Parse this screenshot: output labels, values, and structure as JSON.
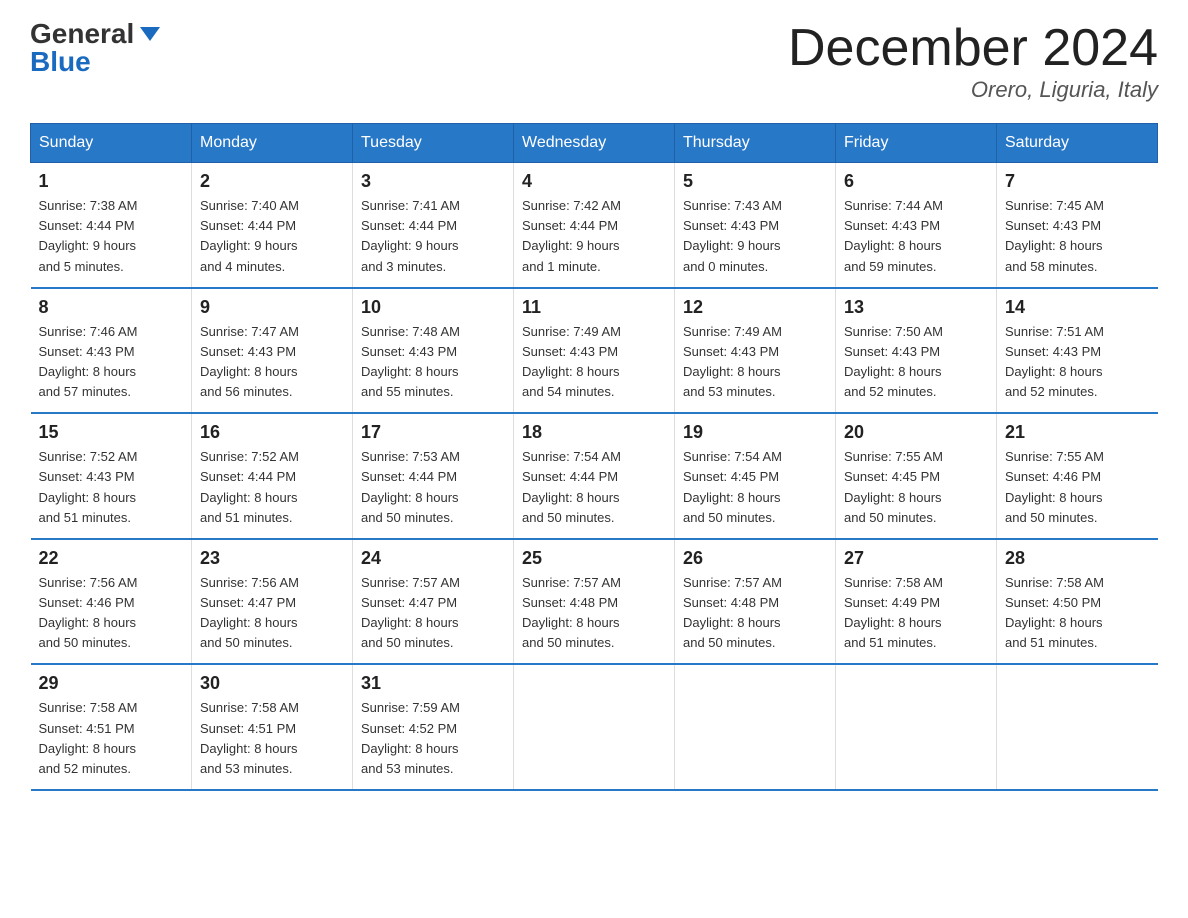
{
  "logo": {
    "general": "General",
    "blue": "Blue"
  },
  "title": "December 2024",
  "location": "Orero, Liguria, Italy",
  "days_of_week": [
    "Sunday",
    "Monday",
    "Tuesday",
    "Wednesday",
    "Thursday",
    "Friday",
    "Saturday"
  ],
  "weeks": [
    [
      {
        "num": "1",
        "sunrise": "7:38 AM",
        "sunset": "4:44 PM",
        "daylight": "9 hours and 5 minutes."
      },
      {
        "num": "2",
        "sunrise": "7:40 AM",
        "sunset": "4:44 PM",
        "daylight": "9 hours and 4 minutes."
      },
      {
        "num": "3",
        "sunrise": "7:41 AM",
        "sunset": "4:44 PM",
        "daylight": "9 hours and 3 minutes."
      },
      {
        "num": "4",
        "sunrise": "7:42 AM",
        "sunset": "4:44 PM",
        "daylight": "9 hours and 1 minute."
      },
      {
        "num": "5",
        "sunrise": "7:43 AM",
        "sunset": "4:43 PM",
        "daylight": "9 hours and 0 minutes."
      },
      {
        "num": "6",
        "sunrise": "7:44 AM",
        "sunset": "4:43 PM",
        "daylight": "8 hours and 59 minutes."
      },
      {
        "num": "7",
        "sunrise": "7:45 AM",
        "sunset": "4:43 PM",
        "daylight": "8 hours and 58 minutes."
      }
    ],
    [
      {
        "num": "8",
        "sunrise": "7:46 AM",
        "sunset": "4:43 PM",
        "daylight": "8 hours and 57 minutes."
      },
      {
        "num": "9",
        "sunrise": "7:47 AM",
        "sunset": "4:43 PM",
        "daylight": "8 hours and 56 minutes."
      },
      {
        "num": "10",
        "sunrise": "7:48 AM",
        "sunset": "4:43 PM",
        "daylight": "8 hours and 55 minutes."
      },
      {
        "num": "11",
        "sunrise": "7:49 AM",
        "sunset": "4:43 PM",
        "daylight": "8 hours and 54 minutes."
      },
      {
        "num": "12",
        "sunrise": "7:49 AM",
        "sunset": "4:43 PM",
        "daylight": "8 hours and 53 minutes."
      },
      {
        "num": "13",
        "sunrise": "7:50 AM",
        "sunset": "4:43 PM",
        "daylight": "8 hours and 52 minutes."
      },
      {
        "num": "14",
        "sunrise": "7:51 AM",
        "sunset": "4:43 PM",
        "daylight": "8 hours and 52 minutes."
      }
    ],
    [
      {
        "num": "15",
        "sunrise": "7:52 AM",
        "sunset": "4:43 PM",
        "daylight": "8 hours and 51 minutes."
      },
      {
        "num": "16",
        "sunrise": "7:52 AM",
        "sunset": "4:44 PM",
        "daylight": "8 hours and 51 minutes."
      },
      {
        "num": "17",
        "sunrise": "7:53 AM",
        "sunset": "4:44 PM",
        "daylight": "8 hours and 50 minutes."
      },
      {
        "num": "18",
        "sunrise": "7:54 AM",
        "sunset": "4:44 PM",
        "daylight": "8 hours and 50 minutes."
      },
      {
        "num": "19",
        "sunrise": "7:54 AM",
        "sunset": "4:45 PM",
        "daylight": "8 hours and 50 minutes."
      },
      {
        "num": "20",
        "sunrise": "7:55 AM",
        "sunset": "4:45 PM",
        "daylight": "8 hours and 50 minutes."
      },
      {
        "num": "21",
        "sunrise": "7:55 AM",
        "sunset": "4:46 PM",
        "daylight": "8 hours and 50 minutes."
      }
    ],
    [
      {
        "num": "22",
        "sunrise": "7:56 AM",
        "sunset": "4:46 PM",
        "daylight": "8 hours and 50 minutes."
      },
      {
        "num": "23",
        "sunrise": "7:56 AM",
        "sunset": "4:47 PM",
        "daylight": "8 hours and 50 minutes."
      },
      {
        "num": "24",
        "sunrise": "7:57 AM",
        "sunset": "4:47 PM",
        "daylight": "8 hours and 50 minutes."
      },
      {
        "num": "25",
        "sunrise": "7:57 AM",
        "sunset": "4:48 PM",
        "daylight": "8 hours and 50 minutes."
      },
      {
        "num": "26",
        "sunrise": "7:57 AM",
        "sunset": "4:48 PM",
        "daylight": "8 hours and 50 minutes."
      },
      {
        "num": "27",
        "sunrise": "7:58 AM",
        "sunset": "4:49 PM",
        "daylight": "8 hours and 51 minutes."
      },
      {
        "num": "28",
        "sunrise": "7:58 AM",
        "sunset": "4:50 PM",
        "daylight": "8 hours and 51 minutes."
      }
    ],
    [
      {
        "num": "29",
        "sunrise": "7:58 AM",
        "sunset": "4:51 PM",
        "daylight": "8 hours and 52 minutes."
      },
      {
        "num": "30",
        "sunrise": "7:58 AM",
        "sunset": "4:51 PM",
        "daylight": "8 hours and 53 minutes."
      },
      {
        "num": "31",
        "sunrise": "7:59 AM",
        "sunset": "4:52 PM",
        "daylight": "8 hours and 53 minutes."
      },
      null,
      null,
      null,
      null
    ]
  ],
  "labels": {
    "sunrise": "Sunrise:",
    "sunset": "Sunset:",
    "daylight": "Daylight:"
  }
}
